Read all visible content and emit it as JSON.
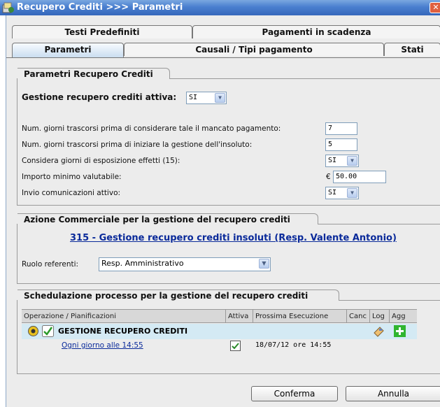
{
  "window": {
    "title": "Recupero Crediti >>> Parametri",
    "close": "✕"
  },
  "tabs_row1": [
    {
      "label": "Testi Predefiniti"
    },
    {
      "label": "Pagamenti in scadenza"
    }
  ],
  "tabs_row2": [
    {
      "label": "Parametri"
    },
    {
      "label": "Causali / Tipi pagamento"
    },
    {
      "label": "Stati"
    }
  ],
  "parametri": {
    "legend": "Parametri Recupero Crediti",
    "gestione_label": "Gestione recupero crediti attiva:",
    "gestione_value": "SI",
    "rows": [
      {
        "label": "Num. giorni trascorsi prima di considerare tale il mancato pagamento:",
        "value": "7"
      },
      {
        "label": "Num. giorni trascorsi prima di iniziare la gestione dell'insoluto:",
        "value": "5"
      },
      {
        "label": "Considera giorni di esposizione effetti (15):",
        "value": "SI"
      },
      {
        "label": "Importo minimo valutabile:",
        "currency": "€",
        "value": "50.00"
      },
      {
        "label": "Invio comunicazioni attivo:",
        "value": "SI"
      }
    ]
  },
  "azione": {
    "legend": "Azione Commerciale per la gestione del recupero crediti",
    "link": "315 - Gestione recupero crediti insoluti (Resp. Valente Antonio)",
    "ruolo_label": "Ruolo referenti:",
    "ruolo_value": "Resp. Amministrativo"
  },
  "schedulazione": {
    "legend": "Schedulazione processo per la gestione del recupero crediti",
    "columns": [
      "Operazione / Pianificazioni",
      "Attiva",
      "Prossima Esecuzione",
      "Canc",
      "Log",
      "Agg"
    ],
    "group": {
      "name": "GESTIONE RECUPERO CREDITI"
    },
    "row": {
      "name": "Ogni giorno alle 14:55",
      "next": "18/07/12 ore 14:55"
    }
  },
  "buttons": {
    "confirm": "Conferma",
    "cancel": "Annulla"
  },
  "colors": {
    "title_bar": "#4a7fcf",
    "link": "#0a2a9a",
    "accent_green": "#2fb52f"
  }
}
